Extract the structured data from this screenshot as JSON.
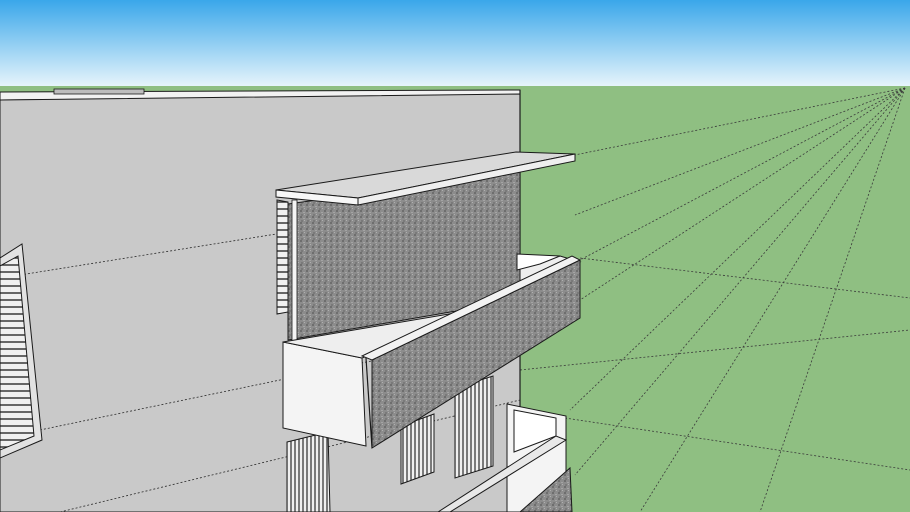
{
  "colors": {
    "sky_top": "#3aa7ea",
    "sky_bottom": "#e6f4fb",
    "ground": "#8fbf82",
    "wall_front": "#c9c9c9",
    "wall_edge": "#ffffff",
    "slab": "#d9d9d9",
    "panel": "#8a8a8a",
    "shutter": "#e8e8e8",
    "line": "#1a1a1a",
    "guide": "#3a3a3a"
  }
}
